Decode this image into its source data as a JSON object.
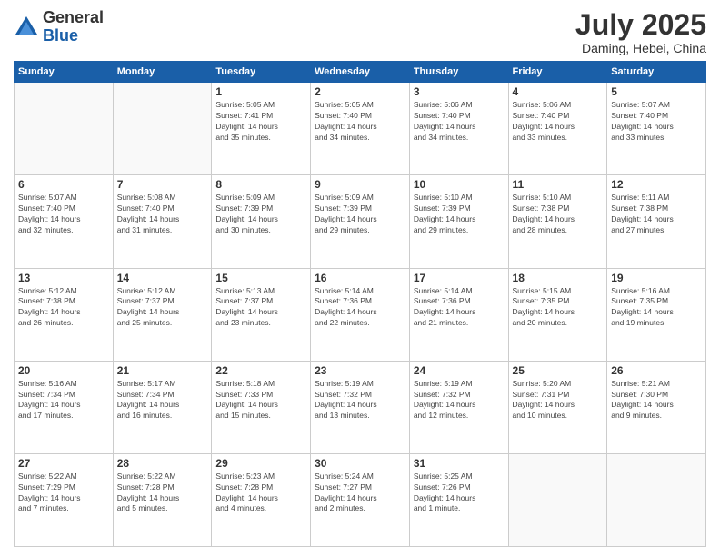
{
  "header": {
    "logo_general": "General",
    "logo_blue": "Blue",
    "title": "July 2025",
    "location": "Daming, Hebei, China"
  },
  "days_of_week": [
    "Sunday",
    "Monday",
    "Tuesday",
    "Wednesday",
    "Thursday",
    "Friday",
    "Saturday"
  ],
  "weeks": [
    [
      {
        "day": "",
        "info": ""
      },
      {
        "day": "",
        "info": ""
      },
      {
        "day": "1",
        "info": "Sunrise: 5:05 AM\nSunset: 7:41 PM\nDaylight: 14 hours\nand 35 minutes."
      },
      {
        "day": "2",
        "info": "Sunrise: 5:05 AM\nSunset: 7:40 PM\nDaylight: 14 hours\nand 34 minutes."
      },
      {
        "day": "3",
        "info": "Sunrise: 5:06 AM\nSunset: 7:40 PM\nDaylight: 14 hours\nand 34 minutes."
      },
      {
        "day": "4",
        "info": "Sunrise: 5:06 AM\nSunset: 7:40 PM\nDaylight: 14 hours\nand 33 minutes."
      },
      {
        "day": "5",
        "info": "Sunrise: 5:07 AM\nSunset: 7:40 PM\nDaylight: 14 hours\nand 33 minutes."
      }
    ],
    [
      {
        "day": "6",
        "info": "Sunrise: 5:07 AM\nSunset: 7:40 PM\nDaylight: 14 hours\nand 32 minutes."
      },
      {
        "day": "7",
        "info": "Sunrise: 5:08 AM\nSunset: 7:40 PM\nDaylight: 14 hours\nand 31 minutes."
      },
      {
        "day": "8",
        "info": "Sunrise: 5:09 AM\nSunset: 7:39 PM\nDaylight: 14 hours\nand 30 minutes."
      },
      {
        "day": "9",
        "info": "Sunrise: 5:09 AM\nSunset: 7:39 PM\nDaylight: 14 hours\nand 29 minutes."
      },
      {
        "day": "10",
        "info": "Sunrise: 5:10 AM\nSunset: 7:39 PM\nDaylight: 14 hours\nand 29 minutes."
      },
      {
        "day": "11",
        "info": "Sunrise: 5:10 AM\nSunset: 7:38 PM\nDaylight: 14 hours\nand 28 minutes."
      },
      {
        "day": "12",
        "info": "Sunrise: 5:11 AM\nSunset: 7:38 PM\nDaylight: 14 hours\nand 27 minutes."
      }
    ],
    [
      {
        "day": "13",
        "info": "Sunrise: 5:12 AM\nSunset: 7:38 PM\nDaylight: 14 hours\nand 26 minutes."
      },
      {
        "day": "14",
        "info": "Sunrise: 5:12 AM\nSunset: 7:37 PM\nDaylight: 14 hours\nand 25 minutes."
      },
      {
        "day": "15",
        "info": "Sunrise: 5:13 AM\nSunset: 7:37 PM\nDaylight: 14 hours\nand 23 minutes."
      },
      {
        "day": "16",
        "info": "Sunrise: 5:14 AM\nSunset: 7:36 PM\nDaylight: 14 hours\nand 22 minutes."
      },
      {
        "day": "17",
        "info": "Sunrise: 5:14 AM\nSunset: 7:36 PM\nDaylight: 14 hours\nand 21 minutes."
      },
      {
        "day": "18",
        "info": "Sunrise: 5:15 AM\nSunset: 7:35 PM\nDaylight: 14 hours\nand 20 minutes."
      },
      {
        "day": "19",
        "info": "Sunrise: 5:16 AM\nSunset: 7:35 PM\nDaylight: 14 hours\nand 19 minutes."
      }
    ],
    [
      {
        "day": "20",
        "info": "Sunrise: 5:16 AM\nSunset: 7:34 PM\nDaylight: 14 hours\nand 17 minutes."
      },
      {
        "day": "21",
        "info": "Sunrise: 5:17 AM\nSunset: 7:34 PM\nDaylight: 14 hours\nand 16 minutes."
      },
      {
        "day": "22",
        "info": "Sunrise: 5:18 AM\nSunset: 7:33 PM\nDaylight: 14 hours\nand 15 minutes."
      },
      {
        "day": "23",
        "info": "Sunrise: 5:19 AM\nSunset: 7:32 PM\nDaylight: 14 hours\nand 13 minutes."
      },
      {
        "day": "24",
        "info": "Sunrise: 5:19 AM\nSunset: 7:32 PM\nDaylight: 14 hours\nand 12 minutes."
      },
      {
        "day": "25",
        "info": "Sunrise: 5:20 AM\nSunset: 7:31 PM\nDaylight: 14 hours\nand 10 minutes."
      },
      {
        "day": "26",
        "info": "Sunrise: 5:21 AM\nSunset: 7:30 PM\nDaylight: 14 hours\nand 9 minutes."
      }
    ],
    [
      {
        "day": "27",
        "info": "Sunrise: 5:22 AM\nSunset: 7:29 PM\nDaylight: 14 hours\nand 7 minutes."
      },
      {
        "day": "28",
        "info": "Sunrise: 5:22 AM\nSunset: 7:28 PM\nDaylight: 14 hours\nand 5 minutes."
      },
      {
        "day": "29",
        "info": "Sunrise: 5:23 AM\nSunset: 7:28 PM\nDaylight: 14 hours\nand 4 minutes."
      },
      {
        "day": "30",
        "info": "Sunrise: 5:24 AM\nSunset: 7:27 PM\nDaylight: 14 hours\nand 2 minutes."
      },
      {
        "day": "31",
        "info": "Sunrise: 5:25 AM\nSunset: 7:26 PM\nDaylight: 14 hours\nand 1 minute."
      },
      {
        "day": "",
        "info": ""
      },
      {
        "day": "",
        "info": ""
      }
    ]
  ]
}
